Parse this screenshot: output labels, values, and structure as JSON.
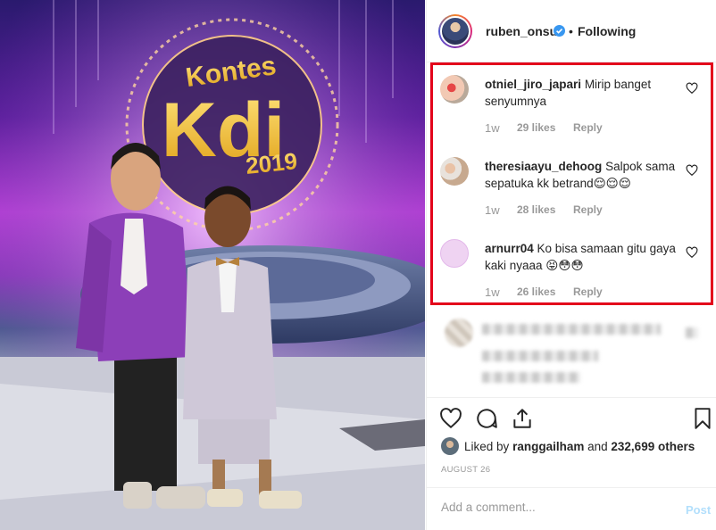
{
  "post": {
    "username": "ruben_onsu",
    "separator": "•",
    "follow_status": "Following",
    "photo_sign_line1": "Kontes",
    "photo_sign_line2": "Kdi",
    "photo_sign_line3": "2019"
  },
  "comments": [
    {
      "user": "otniel_jiro_japari",
      "text": "Mirip banget senyumnya",
      "time": "1w",
      "likes": "29 likes",
      "reply": "Reply"
    },
    {
      "user": "theresiaayu_dehoog",
      "text": "Salpok sama sepatuka kk betrand😌😌😌",
      "time": "1w",
      "likes": "28 likes",
      "reply": "Reply"
    },
    {
      "user": "arnurr04",
      "text": "Ko bisa samaan gitu gaya kaki nyaaa 😝😳😳",
      "time": "1w",
      "likes": "26 likes",
      "reply": "Reply"
    }
  ],
  "likes": {
    "prefix": "Liked by",
    "user": "ranggailham",
    "and": "and",
    "others": "232,699 others"
  },
  "date": "AUGUST 26",
  "add_comment": {
    "placeholder": "Add a comment...",
    "post_label": "Post"
  },
  "colors": {
    "highlight": "#e3001b",
    "verified": "#3897f0",
    "post_disabled": "#b2dffc"
  },
  "icons": [
    "verified-icon",
    "heart-icon",
    "comment-icon",
    "share-icon",
    "bookmark-icon"
  ]
}
